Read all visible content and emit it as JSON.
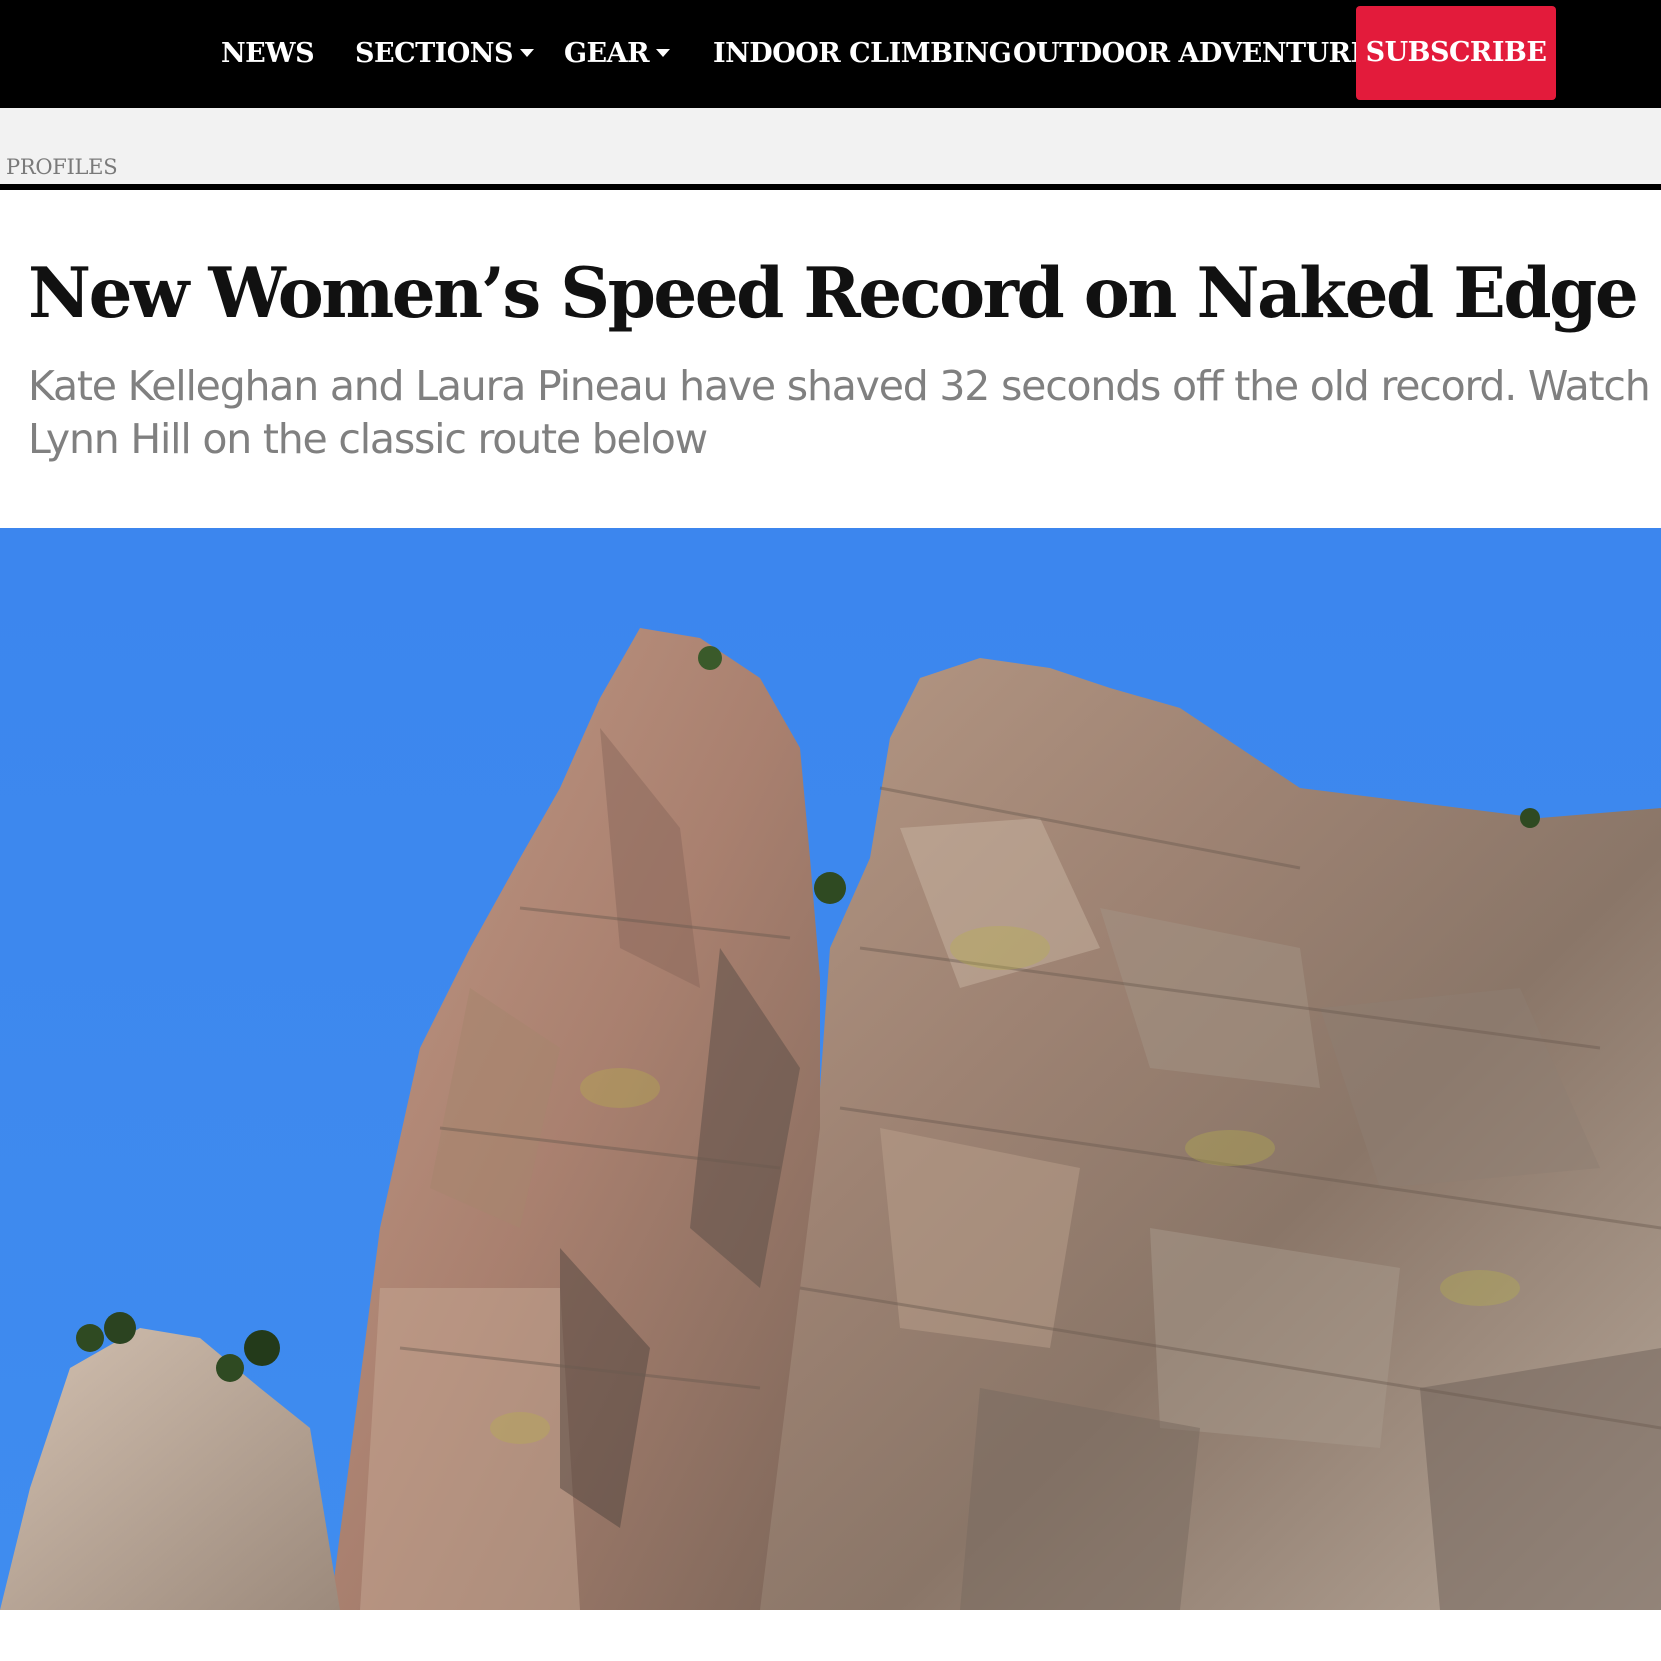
{
  "nav": {
    "items": [
      {
        "label": "NEWS",
        "has_dropdown": false
      },
      {
        "label": "SECTIONS",
        "has_dropdown": true
      },
      {
        "label": "GEAR",
        "has_dropdown": true
      },
      {
        "label": "INDOOR CLIMBING",
        "has_dropdown": false
      },
      {
        "label": "OUTDOOR ADVENTURE",
        "has_dropdown": false
      }
    ],
    "subscribe_label": "SUBSCRIBE",
    "caret_icon": "chevron-down-icon"
  },
  "breadcrumb": {
    "label": "PROFILES"
  },
  "article": {
    "title": "New Women’s Speed Record on Naked Edge",
    "dek": "Kate Kelleghan and Laura Pineau have shaved 32 seconds off the old record. Watch Lynn Hill on the classic route below"
  },
  "colors": {
    "nav_background": "#000000",
    "subscribe_background": "#e31b3b",
    "breadcrumb_bar": "#f2f2f2",
    "breadcrumb_text": "#7a7a7a",
    "title_text": "#111111",
    "dek_text": "#808080",
    "sky": "#3d86ed"
  }
}
